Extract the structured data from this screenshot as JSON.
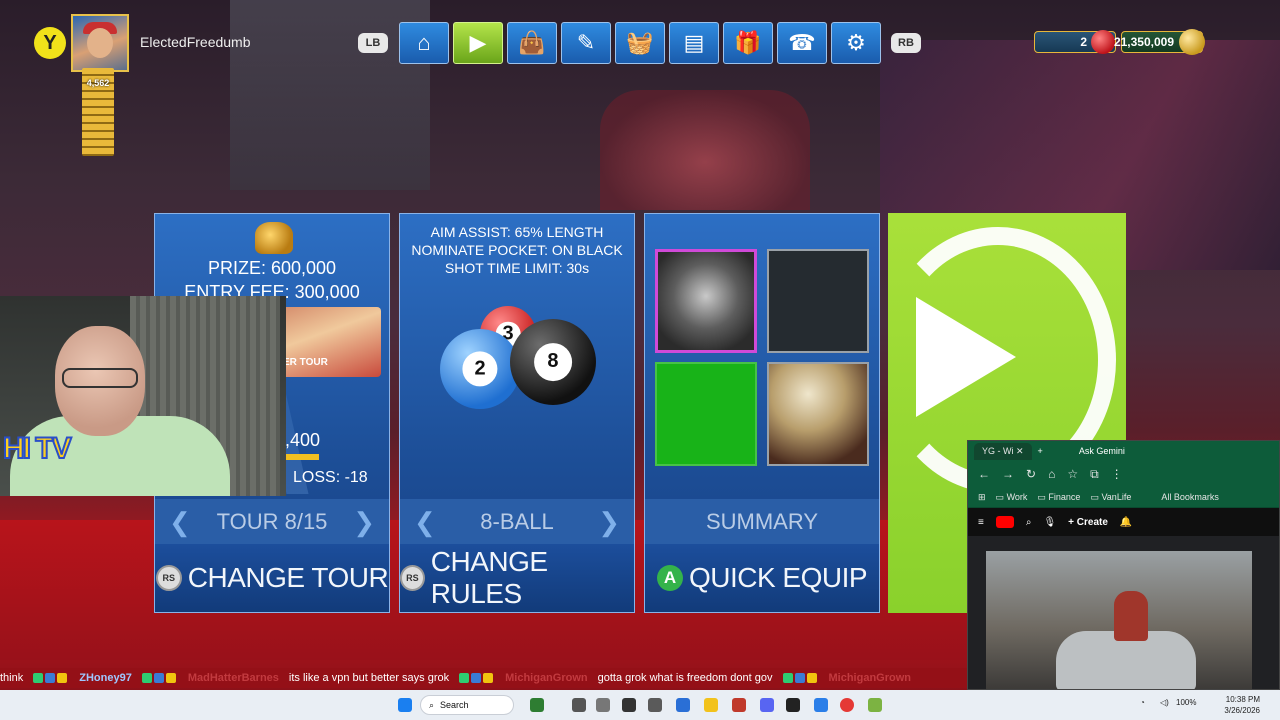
{
  "player": {
    "controller_y": "Y",
    "username": "ElectedFreedumb",
    "rank_level": "4,562"
  },
  "controls": {
    "lb": "LB",
    "rb": "RB"
  },
  "nav_icons": [
    "home-icon",
    "play-icon",
    "shop-bag-icon",
    "cue-icon",
    "basket-icon",
    "news-icon",
    "gift-icon",
    "support-icon",
    "settings-icon"
  ],
  "nav_glyphs": [
    "⌂",
    "▶",
    "👜",
    "✎",
    "🧺",
    "▤",
    "🎁",
    "☎",
    "⚙"
  ],
  "currency": {
    "gems": "2",
    "coins": "21,350,009"
  },
  "tour_card": {
    "prize": "PRIZE: 600,000",
    "entry_fee": "ENTRY FEE: 300,000",
    "banner_text": "ER TOUR",
    "amount": ",400",
    "loss": "LOSS: -18",
    "nav_label": "TOUR 8/15",
    "action_button": "RS",
    "action_label": "CHANGE TOUR"
  },
  "rules_card": {
    "aim_assist": "AIM ASSIST: 65% LENGTH",
    "nominate": "NOMINATE POCKET: ON BLACK",
    "shot_time": "SHOT TIME LIMIT: 30s",
    "balls": [
      "3",
      "2",
      "8"
    ],
    "nav_label": "8-BALL",
    "action_button": "RS",
    "action_label": "CHANGE RULES"
  },
  "summary_card": {
    "label": "SUMMARY",
    "action_button": "A",
    "action_label": "QUICK EQUIP"
  },
  "ticker": [
    {
      "type": "msg",
      "text": "think"
    },
    {
      "type": "user",
      "text": "ZHoney97"
    },
    {
      "type": "user-faint",
      "text": "MadHatterBarnes"
    },
    {
      "type": "msg",
      "text": "its like a vpn but better says grok"
    },
    {
      "type": "user-faint",
      "text": "MichiganGrown"
    },
    {
      "type": "msg",
      "text": "gotta grok what is freedom dont gov"
    },
    {
      "type": "user-faint",
      "text": "MichiganGrown"
    }
  ],
  "browser": {
    "tab_title": "YG - Wi",
    "gemini": "Ask Gemini",
    "bookmarks": [
      "Work",
      "Finance",
      "VanLife"
    ],
    "all_bookmarks": "All Bookmarks",
    "create": "Create"
  },
  "taskbar": {
    "search": "Search",
    "battery": "100%",
    "time": "10:38 PM",
    "date": "3/26/2026"
  },
  "colors": {
    "accent_blue": "#1d4f98",
    "play_green": "#8ad12c",
    "floor_red": "#b3141d"
  }
}
